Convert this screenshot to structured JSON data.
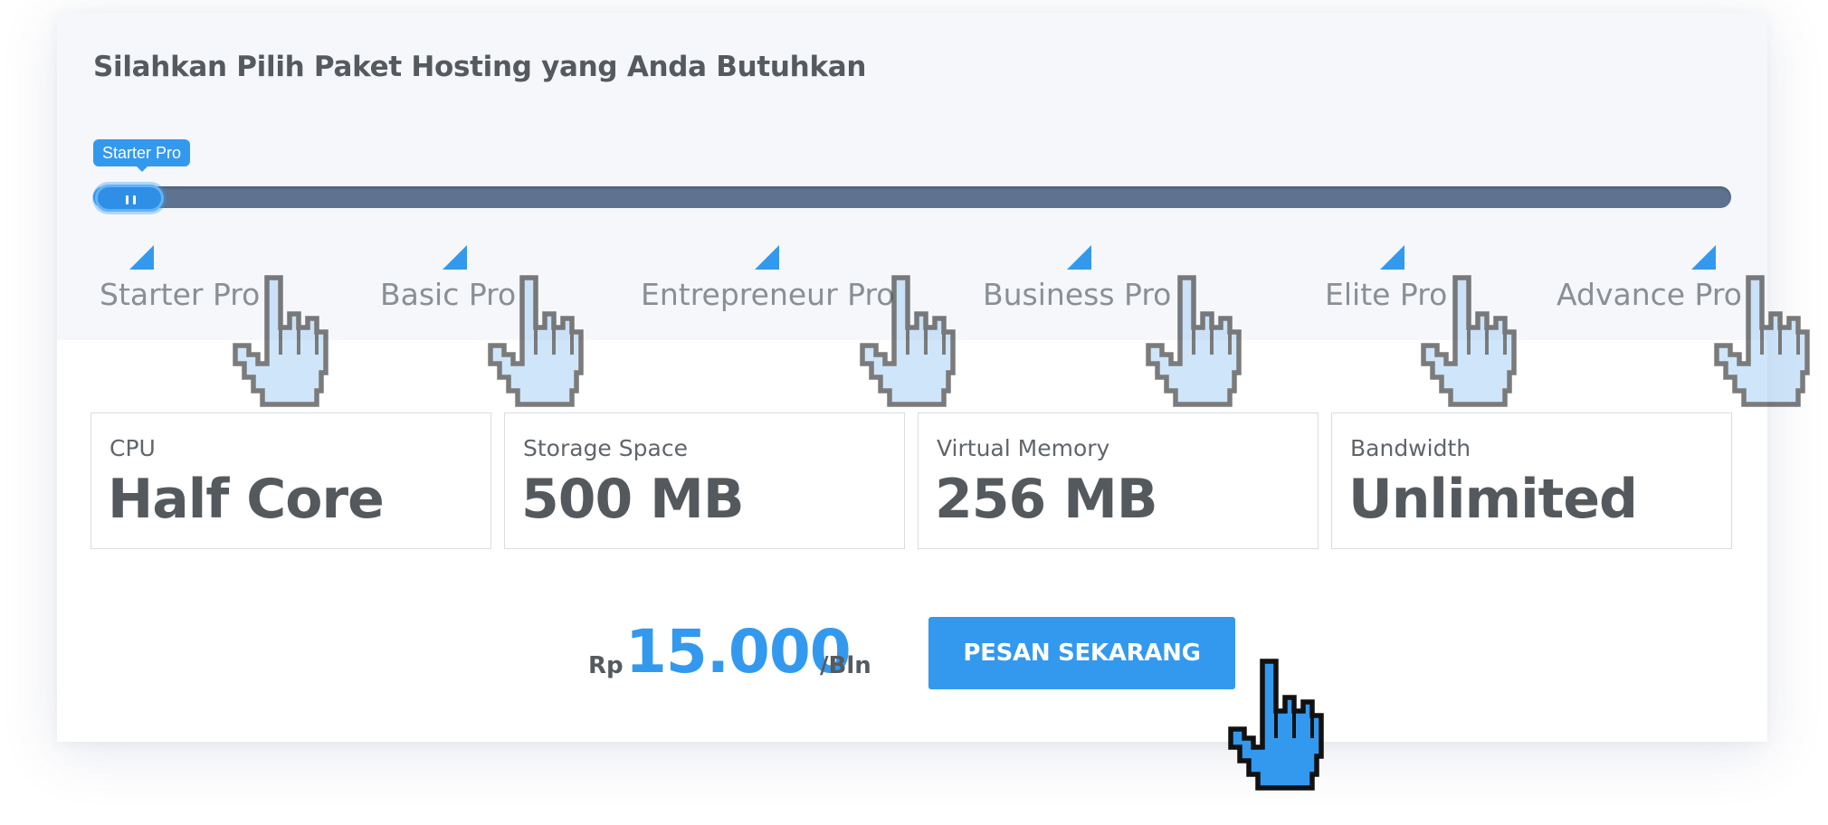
{
  "heading": "Silahkan Pilih Paket Hosting yang Anda Butuhkan",
  "slider": {
    "selected": "Starter Pro",
    "selected_index": 0,
    "position_percent": 0
  },
  "plans": [
    {
      "label": "Starter Pro"
    },
    {
      "label": "Basic Pro"
    },
    {
      "label": "Entrepreneur Pro"
    },
    {
      "label": "Business Pro"
    },
    {
      "label": "Elite Pro"
    },
    {
      "label": "Advance Pro"
    }
  ],
  "specs": [
    {
      "label": "CPU",
      "value": "Half Core"
    },
    {
      "label": "Storage Space",
      "value": "500 MB"
    },
    {
      "label": "Virtual Memory",
      "value": "256 MB"
    },
    {
      "label": "Bandwidth",
      "value": "Unlimited"
    }
  ],
  "price": {
    "currency": "Rp",
    "amount": "15.000",
    "period": "/Bln"
  },
  "order_button": {
    "label": "PESAN SEKARANG"
  },
  "colors": {
    "accent": "#3399ee",
    "track": "#5f7390",
    "text_dark": "#555a5f",
    "text_muted": "#8a8f96"
  },
  "icons": {
    "plan_hand": "pointer-hand-icon",
    "order_cursor": "pointer-hand-cursor-icon",
    "slider_grip": "slider-grip-icon"
  }
}
